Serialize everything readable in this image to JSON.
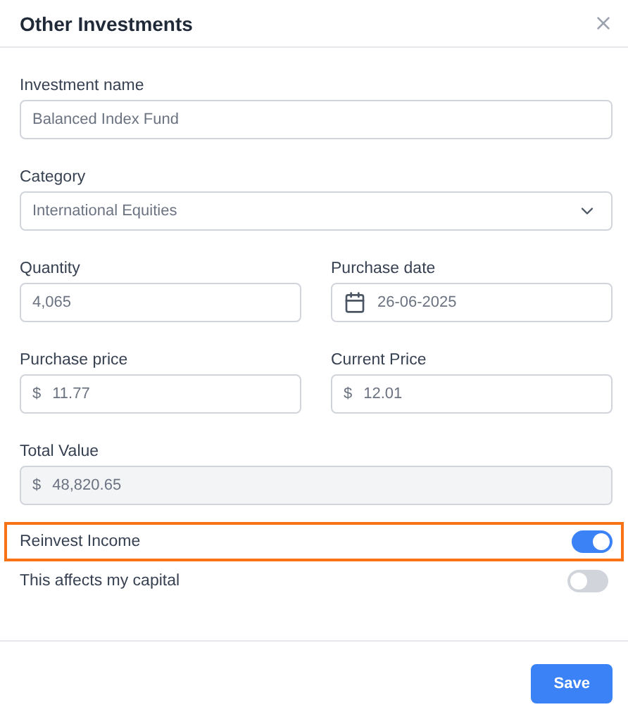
{
  "dialog": {
    "title": "Other Investments"
  },
  "rows": [
    {
      "fields": [
        {
          "kind": "text",
          "label": "Investment name",
          "value": "Balanced Index Fund"
        }
      ]
    },
    {
      "fields": [
        {
          "kind": "select",
          "label": "Category",
          "value": "International Equities"
        }
      ]
    },
    {
      "fields": [
        {
          "kind": "text",
          "label": "Quantity",
          "value": "4,065"
        },
        {
          "kind": "date",
          "label": "Purchase date",
          "value": "26-06-2025"
        }
      ]
    },
    {
      "fields": [
        {
          "kind": "currency",
          "label": "Purchase price",
          "prefix": "$",
          "value": "11.77"
        },
        {
          "kind": "currency",
          "label": "Current Price",
          "prefix": "$",
          "value": "12.01"
        }
      ]
    },
    {
      "fields": [
        {
          "kind": "currency",
          "label": "Total Value",
          "prefix": "$",
          "value": "48,820.65",
          "disabled": true
        }
      ]
    }
  ],
  "toggles": [
    {
      "label": "Reinvest Income",
      "on": true,
      "highlighted": true
    },
    {
      "label": "This affects my capital",
      "on": false,
      "highlighted": false
    }
  ],
  "buttons": [
    {
      "label": "Save"
    }
  ]
}
